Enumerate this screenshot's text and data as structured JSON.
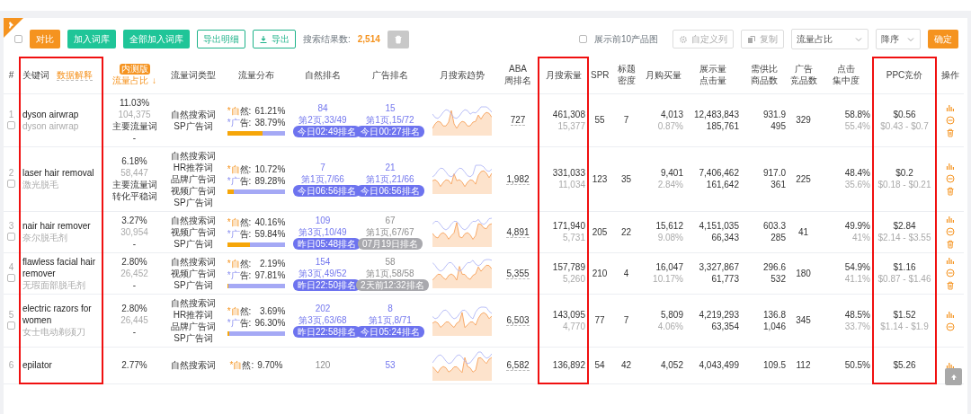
{
  "toolbar": {
    "select_all_checked": false,
    "buttons": [
      {
        "label": "对比",
        "kind": "orange"
      },
      {
        "label": "加入词库",
        "kind": "green"
      },
      {
        "label": "全部加入词库",
        "kind": "green"
      },
      {
        "label": "导出明细",
        "kind": "outline"
      },
      {
        "label": "导出",
        "kind": "outline-download"
      }
    ],
    "result_label": "搜索结果数:",
    "result_count": "2,514",
    "show_images": {
      "label": "展示前10产品图",
      "checked": false
    },
    "custom_columns": "自定义列",
    "copy": "复制",
    "sort_field": "流量占比",
    "sort_order": "降序",
    "confirm": "确定"
  },
  "columns": [
    {
      "label": "#",
      "highlighted": false
    },
    {
      "label": "关键词",
      "link": "数据解释",
      "highlighted": true
    },
    {
      "label": "流量占比",
      "badge": "内测版",
      "sort": "↓",
      "highlighted": false
    },
    {
      "label": "流量词类型",
      "highlighted": false
    },
    {
      "label": "流量分布",
      "highlighted": false
    },
    {
      "label": "自然排名",
      "highlighted": false
    },
    {
      "label": "广告排名",
      "highlighted": false
    },
    {
      "label": "月搜索趋势",
      "highlighted": false
    },
    {
      "label_lines": [
        "ABA",
        "周排名"
      ],
      "highlighted": false
    },
    {
      "label": "月搜索量",
      "highlighted": true
    },
    {
      "label": "SPR",
      "highlighted": false
    },
    {
      "label_lines": [
        "标题",
        "密度"
      ],
      "highlighted": false
    },
    {
      "label": "月购买量",
      "highlighted": false
    },
    {
      "label_lines": [
        "展示量",
        "点击量"
      ],
      "highlighted": false
    },
    {
      "label_lines": [
        "需供比",
        "商品数"
      ],
      "highlighted": false
    },
    {
      "label_lines": [
        "广告",
        "竞品数"
      ],
      "highlighted": false
    },
    {
      "label_lines": [
        "点击",
        "集中度"
      ],
      "highlighted": false
    },
    {
      "label": "PPC竞价",
      "highlighted": true
    },
    {
      "label": "操作",
      "highlighted": false
    }
  ],
  "rows": [
    {
      "index": "1",
      "checked": false,
      "keyword": "dyson airwrap",
      "translation": "dyson airwrap",
      "share": "11.03%",
      "share_count": "104,375",
      "share_labels": [
        "主要流量词",
        "-"
      ],
      "types": [
        "自然搜索词",
        "SP广告词"
      ],
      "distribution": {
        "natural_label": "*自然:",
        "natural": "61.21%",
        "ad_label": "*广告:",
        "ad": "38.79%",
        "level": 0.6121
      },
      "organic": {
        "rank": "84",
        "page": "第2页,33/49",
        "time": "今日02:49排名",
        "stale": false
      },
      "ad": {
        "rank": "15",
        "page": "第1页,15/72",
        "time": "今日00:27排名",
        "stale": false
      },
      "aba": "727",
      "search": [
        "461,308",
        "15,377"
      ],
      "spr": "55",
      "density": "7",
      "purchases": [
        "4,013",
        "0.87%"
      ],
      "impressions": [
        "12,483,843",
        "185,761"
      ],
      "supply": [
        "931.9",
        "495"
      ],
      "ad_competitors": "329",
      "click": [
        "58.8%",
        "55.4%"
      ],
      "ppc": [
        "$0.56",
        "$0.43 - $0.7"
      ],
      "actions": [
        {
          "kind": "chart"
        },
        {
          "kind": "remove"
        },
        {
          "kind": "delete"
        }
      ]
    },
    {
      "index": "2",
      "checked": false,
      "keyword": "laser hair removal",
      "translation": "激光脱毛",
      "share": "6.18%",
      "share_count": "58,447",
      "share_labels": [
        "主要流量词",
        "转化平稳词"
      ],
      "types": [
        "自然搜索词",
        "HR推荐词",
        "品牌广告词",
        "视频广告词",
        "SP广告词"
      ],
      "distribution": {
        "natural_label": "*自然:",
        "natural": "10.72%",
        "ad_label": "*广告:",
        "ad": "89.28%",
        "level": 0.1072
      },
      "organic": {
        "rank": "7",
        "page": "第1页,7/66",
        "time": "今日06:56排名",
        "stale": false
      },
      "ad": {
        "rank": "21",
        "page": "第1页,21/66",
        "time": "今日06:56排名",
        "stale": false
      },
      "aba": "1,982",
      "search": [
        "331,033",
        "11,034"
      ],
      "spr": "123",
      "density": "35",
      "purchases": [
        "9,401",
        "2.84%"
      ],
      "impressions": [
        "7,406,462",
        "161,642"
      ],
      "supply": [
        "917.0",
        "361"
      ],
      "ad_competitors": "225",
      "click": [
        "48.4%",
        "35.6%"
      ],
      "ppc": [
        "$0.2",
        "$0.18 - $0.21"
      ],
      "actions": [
        {
          "kind": "chart"
        },
        {
          "kind": "remove"
        },
        {
          "kind": "delete"
        }
      ]
    },
    {
      "index": "3",
      "checked": false,
      "keyword": "nair hair remover",
      "translation": "奈尔脱毛剂",
      "share": "3.27%",
      "share_count": "30,954",
      "share_labels": [
        "-"
      ],
      "types": [
        "自然搜索词",
        "视频广告词",
        "SP广告词"
      ],
      "distribution": {
        "natural_label": "*自然:",
        "natural": "40.16%",
        "ad_label": "*广告:",
        "ad": "59.84%",
        "level": 0.4016
      },
      "organic": {
        "rank": "109",
        "page": "第3页,10/49",
        "time": "昨日05:48排名",
        "stale": false
      },
      "ad": {
        "rank": "67",
        "page": "第1页,67/67",
        "time": "07月19日排名",
        "stale": true
      },
      "aba": "4,891",
      "search": [
        "171,940",
        "5,731"
      ],
      "spr": "205",
      "density": "22",
      "purchases": [
        "15,612",
        "9.08%"
      ],
      "impressions": [
        "4,151,035",
        "66,343"
      ],
      "supply": [
        "603.3",
        "285"
      ],
      "ad_competitors": "41",
      "click": [
        "49.9%",
        "41%"
      ],
      "ppc": [
        "$2.84",
        "$2.14 - $3.55"
      ],
      "actions": [
        {
          "kind": "chart"
        },
        {
          "kind": "remove"
        },
        {
          "kind": "delete"
        }
      ]
    },
    {
      "index": "4",
      "checked": false,
      "keyword": "flawless facial hair remover",
      "translation": "无瑕面部脱毛剂",
      "share": "2.80%",
      "share_count": "26,452",
      "share_labels": [
        "-"
      ],
      "types": [
        "自然搜索词",
        "视频广告词",
        "SP广告词"
      ],
      "distribution": {
        "natural_label": "*自然:",
        "natural": "2.19%",
        "ad_label": "*广告:",
        "ad": "97.81%",
        "level": 0.0219
      },
      "organic": {
        "rank": "154",
        "page": "第3页,49/52",
        "time": "昨日22:50排名",
        "stale": false
      },
      "ad": {
        "rank": "58",
        "page": "第1页,58/58",
        "time": "2天前12:32排名",
        "stale": true
      },
      "aba": "5,355",
      "search": [
        "157,789",
        "5,260"
      ],
      "spr": "210",
      "density": "4",
      "purchases": [
        "16,047",
        "10.17%"
      ],
      "impressions": [
        "3,327,867",
        "61,773"
      ],
      "supply": [
        "296.6",
        "532"
      ],
      "ad_competitors": "180",
      "click": [
        "54.9%",
        "41.1%"
      ],
      "ppc": [
        "$1.16",
        "$0.87 - $1.46"
      ],
      "actions": [
        {
          "kind": "chart"
        },
        {
          "kind": "remove"
        },
        {
          "kind": "delete"
        }
      ]
    },
    {
      "index": "5",
      "checked": false,
      "keyword": "electric razors for women",
      "translation": "女士电动剃须刀",
      "share": "2.80%",
      "share_count": "26,445",
      "share_labels": [
        "-"
      ],
      "types": [
        "自然搜索词",
        "HR推荐词",
        "品牌广告词",
        "SP广告词"
      ],
      "distribution": {
        "natural_label": "*自然:",
        "natural": "3.69%",
        "ad_label": "*广告:",
        "ad": "96.30%",
        "level": 0.0369
      },
      "organic": {
        "rank": "202",
        "page": "第3页,63/68",
        "time": "昨日22:58排名",
        "stale": false
      },
      "ad": {
        "rank": "8",
        "page": "第1页,8/71",
        "time": "今日05:24排名",
        "stale": false
      },
      "aba": "6,503",
      "search": [
        "143,095",
        "4,770"
      ],
      "spr": "77",
      "density": "7",
      "purchases": [
        "5,809",
        "4.06%"
      ],
      "impressions": [
        "4,219,293",
        "63,354"
      ],
      "supply": [
        "136.8",
        "1,046"
      ],
      "ad_competitors": "345",
      "click": [
        "48.5%",
        "33.7%"
      ],
      "ppc": [
        "$1.52",
        "$1.14 - $1.9"
      ],
      "actions": [
        {
          "kind": "chart"
        },
        {
          "kind": "remove"
        }
      ]
    },
    {
      "index": "6",
      "keyword": "epilator",
      "share": "2.77%",
      "types": [
        "自然搜索词"
      ],
      "distribution": {
        "natural_label": "*自然:",
        "natural": "9.70%"
      },
      "organic": {
        "rank": "120",
        "stale": true
      },
      "ad": {
        "rank": "53",
        "stale": false
      },
      "aba": "6,582",
      "search": [
        "136,892"
      ],
      "spr": "54",
      "density": "42",
      "purchases": [
        "4,052"
      ],
      "impressions": [
        "4,043,499"
      ],
      "supply": [
        "109.5"
      ],
      "ad_competitors": "112",
      "click": [
        "50.5%"
      ],
      "ppc": [
        "$5.26"
      ],
      "actions": [
        {
          "kind": "chart"
        }
      ]
    }
  ]
}
